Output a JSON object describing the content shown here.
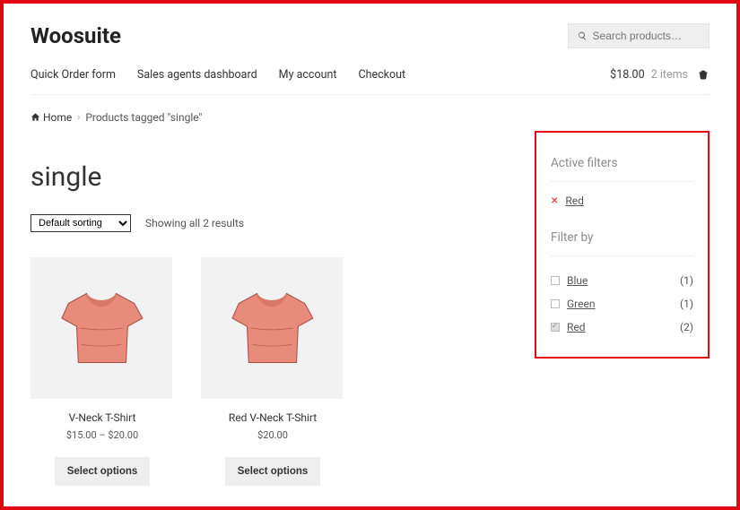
{
  "site": {
    "title": "Woosuite"
  },
  "search": {
    "placeholder": "Search products…"
  },
  "nav": {
    "items": [
      {
        "label": "Quick Order form"
      },
      {
        "label": "Sales agents dashboard"
      },
      {
        "label": "My account"
      },
      {
        "label": "Checkout"
      }
    ]
  },
  "cart": {
    "total": "$18.00",
    "items": "2 items"
  },
  "breadcrumb": {
    "home": "Home",
    "current": "Products tagged \"single\""
  },
  "main": {
    "heading": "single",
    "sort_label": "Default sorting",
    "result_text": "Showing all 2 results"
  },
  "products": [
    {
      "title": "V-Neck T-Shirt",
      "price": "$15.00 – $20.00",
      "button": "Select options"
    },
    {
      "title": "Red V-Neck T-Shirt",
      "price": "$20.00",
      "button": "Select options"
    }
  ],
  "sidebar": {
    "active_title": "Active filters",
    "active": [
      {
        "label": "Red"
      }
    ],
    "filter_title": "Filter by",
    "filters": [
      {
        "label": "Blue",
        "count": "(1)",
        "checked": false
      },
      {
        "label": "Green",
        "count": "(1)",
        "checked": false
      },
      {
        "label": "Red",
        "count": "(2)",
        "checked": true
      }
    ]
  }
}
